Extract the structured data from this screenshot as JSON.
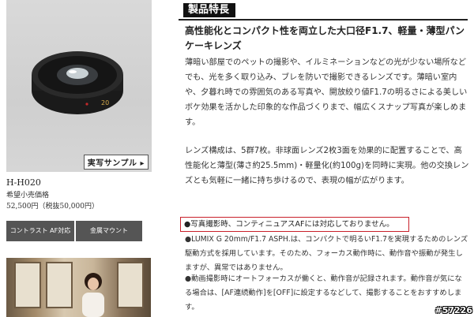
{
  "product": {
    "model": "H-H020",
    "price_label": "希望小売価格",
    "price": "52,500円（税抜50,000円）",
    "sample_button": "実写サンプル ▸",
    "features": [
      "コントラスト AF対応",
      "金属マウント"
    ],
    "lens_text": "20"
  },
  "section": {
    "title": "製品特長",
    "headline": "高性能化とコンパクト性を両立した大口径F1.7、軽量・薄型パンケーキレンズ",
    "para1": "薄暗い部屋でのペットの撮影や、イルミネーションなどの光が少ない場所などでも、光を多く取り込み、ブレを防いで撮影できるレンズです。薄暗い室内や、夕暮れ時での雰囲気のある写真や、開放絞り値F1.7の明るさによる美しいボケ効果を活かした印象的な作品づくりまで、幅広くスナップ写真が楽しめます。",
    "para2": "レンズ構成は、5群7枚。非球面レンズ2枚3面を効果的に配置することで、高性能化と薄型(薄さ約25.5mm)・軽量化(約100g)を同時に実現。他の交換レンズとも気軽に一緒に持ち歩けるので、表現の幅が広がります。",
    "notice": "●写真撮影時、コンティニュアスAFには対応しておりません。",
    "para3": "●LUMIX G 20mm/F1.7 ASPH.は、コンパクトで明るいF1.7を実現するためのレンズ駆動方式を採用しています。そのため、フォーカス動作時に、動作音や振動が発生しますが、異常ではありません。",
    "para4": "●動画撮影時にオートフォーカスが働くと、動作音が記録されます。動作音が気になる場合は、[AF連続動作]を[OFF]に設定するなどして、撮影することをおすすめします。"
  },
  "watermark": "#57226"
}
